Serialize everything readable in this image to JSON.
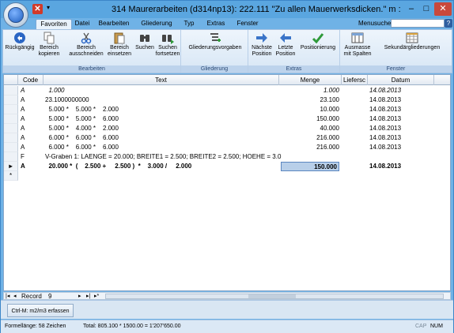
{
  "title": "314 Maurerarbeiten (d314np13): 222.111    \"Zu allen Mauerwerksdicken.\" m :",
  "tabs": [
    "Favoriten",
    "Datei",
    "Bearbeiten",
    "Gliederung",
    "Typ",
    "Extras",
    "Fenster"
  ],
  "menusuche_label": "Menusuche",
  "ribbon": {
    "groups": {
      "bearbeiten": "Bearbeiten",
      "gliederung": "Gliederung",
      "extras": "Extras",
      "fenster": "Fenster"
    },
    "buttons": {
      "rueckgaengig": "Rückgängig",
      "bereich_kopieren": "Bereich kopieren",
      "bereich_ausschneiden": "Bereich ausschneiden",
      "bereich_einsetzen": "Bereich einsetzen",
      "suchen": "Suchen",
      "suchen_fortsetzen": "Suchen fortsetzen",
      "gliederungsvorgaben": "Gliederungsvorgaben",
      "naechste_position": "Nächste Position",
      "letzte_position": "Letzte Position",
      "positionierung": "Positionierung",
      "ausmasse_mit_spalten": "Ausmasse mit Spalten",
      "sekundaergliederungen": "Sekundärgliederungen"
    }
  },
  "grid": {
    "columns": [
      "Code",
      "Text",
      "Menge",
      "Liefersc",
      "Datum"
    ],
    "rows": [
      {
        "code": "A",
        "text": "  1.000",
        "menge": "1.000",
        "datum": "14.08.2013",
        "style": "italic"
      },
      {
        "code": "A",
        "text": "23.1000000000",
        "menge": "23.100",
        "datum": "14.08.2013",
        "style": ""
      },
      {
        "code": "A",
        "text": "  5.000 *    5.000 *    2.000",
        "menge": "10.000",
        "datum": "14.08.2013",
        "style": ""
      },
      {
        "code": "A",
        "text": "  5.000 *    5.000 *    6.000",
        "menge": "150.000",
        "datum": "14.08.2013",
        "style": ""
      },
      {
        "code": "A",
        "text": "  5.000 *    4.000 *    2.000",
        "menge": "40.000",
        "datum": "14.08.2013",
        "style": ""
      },
      {
        "code": "A",
        "text": "  6.000 *    6.000 *    6.000",
        "menge": "216.000",
        "datum": "14.08.2013",
        "style": ""
      },
      {
        "code": "A",
        "text": "  6.000 *    6.000 *    6.000",
        "menge": "216.000",
        "datum": "14.08.2013",
        "style": ""
      },
      {
        "code": "F",
        "text": "V-Graben 1: LAENGE = 20.000; BREITE1 = 2.500; BREITE2 = 2.500; HOEHE = 3.0",
        "menge": "",
        "datum": "",
        "style": ""
      },
      {
        "code": "A",
        "text": "  20.000 *  (    2.500 +     2.500 )  *    3.000 /     2.000",
        "menge": "150.000",
        "datum": "14.08.2013",
        "style": "bold",
        "current": true
      }
    ]
  },
  "record_label": "Record",
  "record_value": "9",
  "ctrl_button": "Ctrl-M: m2/m3 erfassen",
  "status": {
    "formel": "Formellänge: 58 Zeichen",
    "total": "Total: 805.100 * 1500.00 = 1'207'650.00",
    "caps": "CAP",
    "num": "NUM"
  }
}
